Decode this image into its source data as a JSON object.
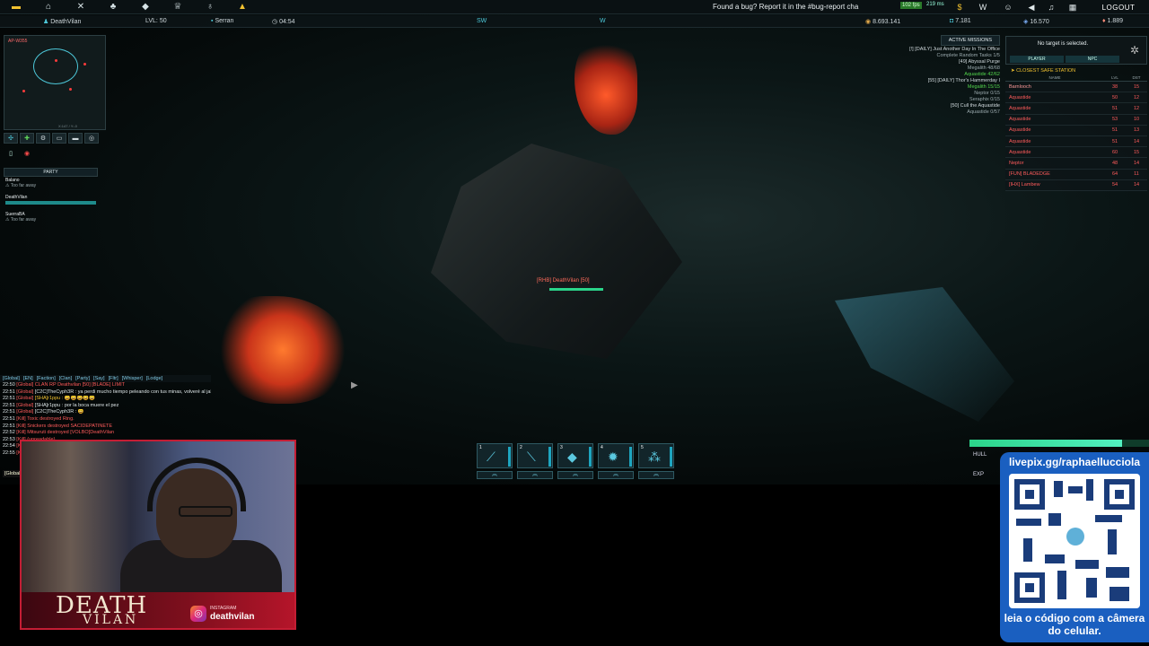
{
  "topbar": {
    "bug_text": "Found a bug? Report it in the #bug-report cha",
    "fps": "102 fps",
    "ping": "219 ms",
    "logout_label": "LOGOUT",
    "right_icons": [
      "$",
      "W",
      "discord-icon",
      "speaker-icon",
      "music-icon",
      "grid-icon"
    ]
  },
  "status": {
    "player_name": "DeathVilan",
    "level": "LVL: 50",
    "location": "Serran",
    "time": "04:54",
    "credits": "8.693.141",
    "currency2": "7.181",
    "currency3": "16.570",
    "currency4": "1.889",
    "compass_sw": "SW",
    "compass_w": "W"
  },
  "minimap": {
    "label": "AP-W355",
    "coords": "X:147 / Y:-0"
  },
  "party": {
    "header": "PARTY",
    "members": [
      {
        "name": "Balano",
        "status": "Too far away"
      },
      {
        "name": "DeathVilan",
        "status": ""
      },
      {
        "name": "SuerraBA",
        "status": "Too far away"
      }
    ]
  },
  "missions": {
    "header": "ACTIVE MISSIONS",
    "lines": [
      {
        "text": "[!] [DAILY] Just Another Day In The Office",
        "cls": ""
      },
      {
        "text": "Complete Random Tasks 1/5",
        "cls": "dim"
      },
      {
        "text": "[49] Abyssal Purge",
        "cls": ""
      },
      {
        "text": "Megalith 48/68",
        "cls": "dim"
      },
      {
        "text": "Aquastide 42/62",
        "cls": "g"
      },
      {
        "text": "[55] [DAILY] Thor's Hammerday I",
        "cls": ""
      },
      {
        "text": "Megalith 15/15",
        "cls": "g"
      },
      {
        "text": "Neptor 0/15",
        "cls": "dim"
      },
      {
        "text": "Seraphix 0/15",
        "cls": "dim"
      },
      {
        "text": "[50] Cull the Aquastide",
        "cls": ""
      },
      {
        "text": "Aquastide 0/57",
        "cls": "dim"
      }
    ]
  },
  "target": {
    "text": "No target is selected.",
    "tab_player": "PLAYER",
    "tab_npc": "NPC"
  },
  "station": {
    "header": "CLOSEST SAFE STATION",
    "col_name": "NAME",
    "col_lvl": "LVL",
    "col_dst": "DST",
    "rows": [
      {
        "name": "Barnlooch",
        "lvl": "38",
        "dst": "15"
      },
      {
        "name": "Aquastide",
        "lvl": "50",
        "dst": "12"
      },
      {
        "name": "Aquastide",
        "lvl": "51",
        "dst": "12"
      },
      {
        "name": "Aquastide",
        "lvl": "53",
        "dst": "10"
      },
      {
        "name": "Aquastide",
        "lvl": "51",
        "dst": "13"
      },
      {
        "name": "Aquastide",
        "lvl": "51",
        "dst": "14"
      },
      {
        "name": "Aquastide",
        "lvl": "60",
        "dst": "15"
      },
      {
        "name": "Neptor",
        "lvl": "48",
        "dst": "14"
      },
      {
        "name": "[FUN] BLADEDGE",
        "lvl": "64",
        "dst": "11"
      },
      {
        "name": "[IHX] Lambew",
        "lvl": "54",
        "dst": "14"
      }
    ]
  },
  "chat": {
    "tabs": [
      "[Global]",
      "[EN]",
      "[Faction]",
      "[Clan]",
      "[Party]",
      "[Say]",
      "[Fltr]",
      "[Whisper]",
      "[Lodge]"
    ],
    "messages": [
      {
        "time": "22:50",
        "ch": "[Global]",
        "text": "CLAN RP Deathvilan [50] [BLADE] LIMIT",
        "cls": "gl"
      },
      {
        "time": "22:51",
        "ch": "[Global]",
        "text": "[C2C]TheCyph3R : ya perdi mucho tiempo peleando con tus minas, volveré al jale.",
        "cls": "w"
      },
      {
        "time": "22:51",
        "ch": "[Global]",
        "text": "[SHA]r1ppu : 😀😀😀😀😀",
        "cls": "y"
      },
      {
        "time": "22:51",
        "ch": "[Global]",
        "text": "[SHA]r1ppu : por la boca muere el pez",
        "cls": "w"
      },
      {
        "time": "22:51",
        "ch": "[Global]",
        "text": "[C2C]TheCyph3R : 😀",
        "cls": "w"
      },
      {
        "time": "22:51",
        "ch": "[Kill]",
        "text": "Toxic destroyed Ring.",
        "cls": "gl"
      },
      {
        "time": "22:51",
        "ch": "[Kill]",
        "text": "Snickers destroyed SACIDEPATINETE",
        "cls": "gl"
      },
      {
        "time": "22:52",
        "ch": "[Kill]",
        "text": "Mitsuruti destroyed [VOLBO]DeathVilan",
        "cls": "gl"
      },
      {
        "time": "22:53",
        "ch": "[Kill]",
        "text": "(unreadable)",
        "cls": "gl"
      },
      {
        "time": "22:54",
        "ch": "[Kill]",
        "text": "(unreadable)",
        "cls": "gl"
      },
      {
        "time": "22:55",
        "ch": "[Kill]",
        "text": "(unreadable)",
        "cls": "gl"
      }
    ],
    "input_prefix": "[Global]"
  },
  "player_label": "[RHB] DeathVilan [50]",
  "hotbar": {
    "slots": [
      {
        "num": "1",
        "icon": "laser-icon"
      },
      {
        "num": "2",
        "icon": "rocket-icon"
      },
      {
        "num": "3",
        "icon": "shield-icon"
      },
      {
        "num": "4",
        "icon": "gear-icon"
      },
      {
        "num": "5",
        "icon": "drone-icon"
      }
    ]
  },
  "ship": {
    "hull_label": "HULL",
    "exp_label": "EXP",
    "hull_fill": 0.85
  },
  "webcam": {
    "brand_top": "DEATH",
    "brand_bottom": "VILAN",
    "ig_label": "INSTAGRAM",
    "ig_handle": "deathvilan"
  },
  "qr": {
    "url": "livepix.gg/raphaellucciola",
    "caption": "leia o código com a câmera do celular."
  }
}
